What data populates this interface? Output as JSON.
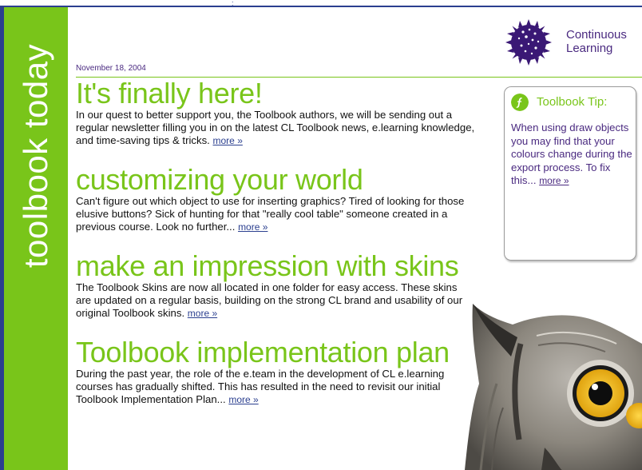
{
  "masthead": {
    "vertical_title": "toolbook today",
    "top_mark": ":"
  },
  "brand": {
    "line1": "Continuous",
    "line2": "Learning"
  },
  "issue": {
    "date": "November 18, 2004"
  },
  "articles": [
    {
      "title": "It's finally here!",
      "body": "In our quest to better support you, the Toolbook authors, we will be sending out a regular newsletter filling you in on the latest CL Toolbook news, e.learning knowledge, and time-saving tips & tricks.",
      "more": "more »"
    },
    {
      "title": "customizing your world",
      "body": "Can't figure out which object to use for inserting graphics? Tired of looking for those elusive buttons? Sick of hunting for that \"really cool table\" someone created in a previous course. Look no further...",
      "more": "more »"
    },
    {
      "title": "make an impression with skins",
      "body": "The Toolbook Skins are now all located in one folder for easy access. These skins are updated on a regular basis, building on the strong CL brand and usability of our original Toolbook skins.",
      "more": "more »"
    },
    {
      "title": "Toolbook implementation plan",
      "body": "During the past year, the role of the e.team in the development of CL e.learning courses has gradually shifted. This has resulted in the need to revisit our initial Toolbook Implementation Plan...",
      "more": "more »"
    }
  ],
  "tip": {
    "title": "Toolbook Tip:",
    "body": "When using draw objects you may find that your colours change during the export process. To fix this...",
    "more": "more »"
  },
  "colors": {
    "green": "#79c51a",
    "purple": "#4a2a80",
    "navy": "#2b3f8f"
  },
  "icons": {
    "logo": "sunburst-logo-icon",
    "tip": "toolbook-tip-icon",
    "image": "owl-photo"
  }
}
